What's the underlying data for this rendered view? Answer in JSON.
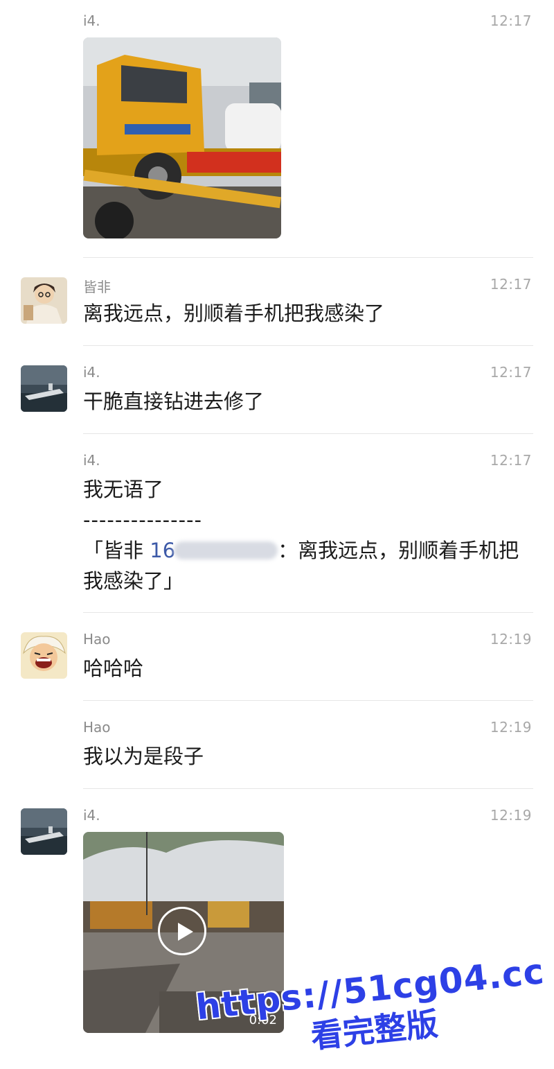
{
  "messages": [
    {
      "sender": "i4.",
      "time": "12:17",
      "type": "image"
    },
    {
      "sender": "皆非",
      "time": "12:17",
      "text": "离我远点，别顺着手机把我感染了"
    },
    {
      "sender": "i4.",
      "time": "12:17",
      "text": "干脆直接钻进去修了"
    },
    {
      "sender": "i4.",
      "time": "12:17",
      "text": "我无语了",
      "separator": "---------------",
      "quote": {
        "open": "「",
        "name": "皆非",
        "id_visible": "16",
        "text_line1": "：离我远点，别顺着手机把",
        "text_line2": "我感染了」"
      }
    },
    {
      "sender": "Hao",
      "time": "12:19",
      "text": "哈哈哈"
    },
    {
      "sender": "Hao",
      "time": "12:19",
      "text": "我以为是段子"
    },
    {
      "sender": "i4.",
      "time": "12:19",
      "type": "video",
      "duration": "0:02"
    }
  ],
  "avatars": {
    "jiefei": "character-avatar",
    "i4": "aircraft-carrier-avatar",
    "hao": "anime-laughing-avatar"
  },
  "watermark": {
    "url": "https://51cg04.cc",
    "cta": "看完整版"
  },
  "colors": {
    "mention": "#3d5aa8",
    "watermark": "#2d40e6"
  }
}
